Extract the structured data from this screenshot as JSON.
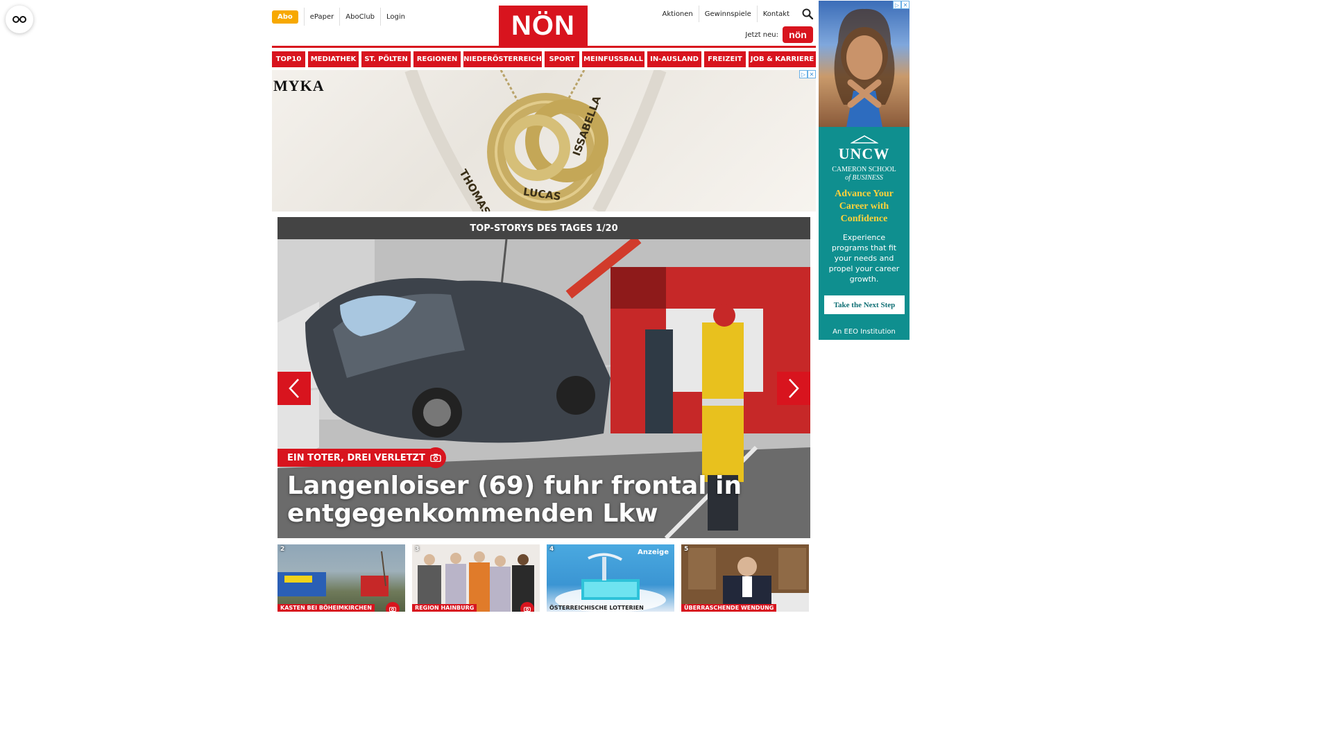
{
  "header": {
    "abo_label": "Abo",
    "left_links": [
      "ePaper",
      "AboClub",
      "Login"
    ],
    "logo_text": "NÖN",
    "right_links": [
      "Aktionen",
      "Gewinnspiele",
      "Kontakt"
    ],
    "jetzt_label": "Jetzt neu:",
    "jetzt_badge": "nön",
    "search_icon": "search-icon"
  },
  "nav": {
    "items": [
      "TOP10",
      "MEDIATHEK",
      "ST. PÖLTEN",
      "REGIONEN",
      "NIEDERÖSTERREICH",
      "SPORT",
      "MEINFUSSBALL",
      "IN-AUSLAND",
      "FREIZEIT",
      "JOB & KARRIERE"
    ]
  },
  "banner_ad": {
    "brand": "MYKA",
    "engraved_names": [
      "THOMAS",
      "LUCAS",
      "ISSABELLA"
    ]
  },
  "sky_ad": {
    "logo": "UNCW",
    "school_line1": "CAMERON SCHOOL",
    "school_line2": "of BUSINESS",
    "headline": "Advance Your Career with Confidence",
    "body": "Experience programs that fit your needs and propel your career growth.",
    "cta": "Take the Next Step",
    "footer": "An EEO Institution"
  },
  "top_stories": {
    "bar_title": "TOP-STORYS DES TAGES 1/20",
    "hero": {
      "kicker": "EIN TOTER, DREI VERLETZTE",
      "title": "Langenloiser (69) fuhr frontal in entgegenkommenden Lkw"
    },
    "thumbs": [
      {
        "num": "2",
        "kicker": "KASTEN BEI BÖHEIMKIRCHEN",
        "has_camera": true,
        "ad": ""
      },
      {
        "num": "3",
        "kicker": "REGION HAINBURG",
        "has_camera": true,
        "ad": ""
      },
      {
        "num": "4",
        "kicker": "ÖSTERREICHISCHE LOTTERIEN",
        "has_camera": false,
        "ad": "Anzeige"
      },
      {
        "num": "5",
        "kicker": "ÜBERRASCHENDE WENDUNG",
        "has_camera": false,
        "ad": ""
      }
    ]
  },
  "colors": {
    "brand_red": "#d8141e",
    "abo_orange": "#f7a800",
    "bar_gray": "#444444",
    "sky_teal": "#0f8f8f",
    "sky_yellow": "#ffd23a"
  }
}
